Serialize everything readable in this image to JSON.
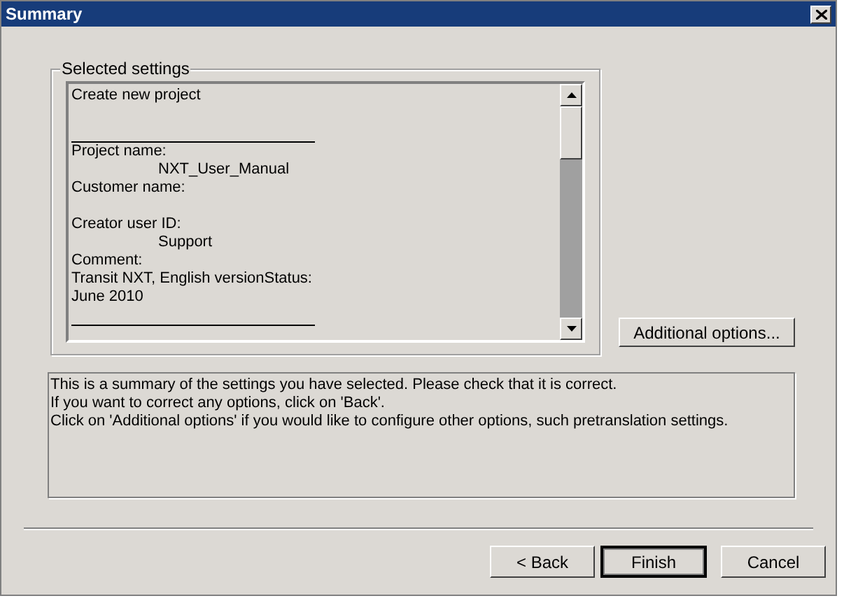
{
  "window": {
    "title": "Summary"
  },
  "selected_settings": {
    "label": "Selected settings",
    "lines": [
      {
        "kind": "text",
        "text": "Create new project"
      },
      {
        "kind": "blank"
      },
      {
        "kind": "blank"
      },
      {
        "kind": "rule"
      },
      {
        "kind": "text",
        "text": "Project name:"
      },
      {
        "kind": "indented",
        "text": "NXT_User_Manual"
      },
      {
        "kind": "text",
        "text": "Customer name:"
      },
      {
        "kind": "blank"
      },
      {
        "kind": "text",
        "text": "Creator user ID:"
      },
      {
        "kind": "indented",
        "text": "Support"
      },
      {
        "kind": "text",
        "text": "Comment:"
      },
      {
        "kind": "text",
        "text": "Transit NXT, English versionStatus:"
      },
      {
        "kind": "text",
        "text": "June 2010"
      },
      {
        "kind": "blank"
      },
      {
        "kind": "rule"
      }
    ]
  },
  "additional_options_button": "Additional options...",
  "info": [
    "This is a summary of the settings you have selected. Please check that it is correct.",
    "If you want to correct any options, click on 'Back'.",
    "Click on 'Additional options' if you would like to configure other options, such pretranslation settings."
  ],
  "buttons": [
    {
      "label": "< Back",
      "default": false
    },
    {
      "label": "Finish",
      "default": true
    },
    {
      "label": "Cancel",
      "default": false
    }
  ]
}
